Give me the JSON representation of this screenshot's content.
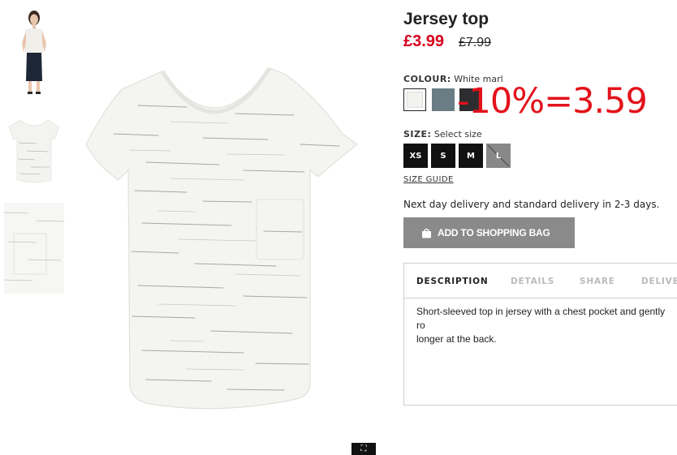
{
  "product": {
    "title": "Jersey top",
    "price_now": "£3.99",
    "price_old": "£7.99"
  },
  "colour": {
    "label": "COLOUR:",
    "selected": "White marl",
    "swatches": [
      {
        "name": "White marl",
        "color": "#f2f2ef"
      },
      {
        "name": "Grey blue",
        "color": "#6a7c84"
      },
      {
        "name": "Dark grey",
        "color": "#2d2d2f"
      }
    ]
  },
  "annotation": "-10%=3.59",
  "size": {
    "label": "SIZE:",
    "prompt": "Select size",
    "options": [
      "XS",
      "S",
      "M",
      "L"
    ],
    "guide": "SIZE GUIDE"
  },
  "delivery_text": "Next day delivery and standard delivery in 2-3 days.",
  "add_to_bag": "ADD TO SHOPPING BAG",
  "tabs": [
    "DESCRIPTION",
    "DETAILS",
    "SHARE",
    "DELIVE"
  ],
  "description": "Short-sleeved top in jersey with a chest pocket and gently ro\nlonger at the back.",
  "colors": {
    "sale_red": "#d6001c",
    "annotation_red": "#e3121b",
    "button_grey": "#8a8a8a",
    "size_black": "#111111"
  },
  "icons": [
    "expand-icon",
    "shopping-bag-icon",
    "strike-out-icon"
  ]
}
